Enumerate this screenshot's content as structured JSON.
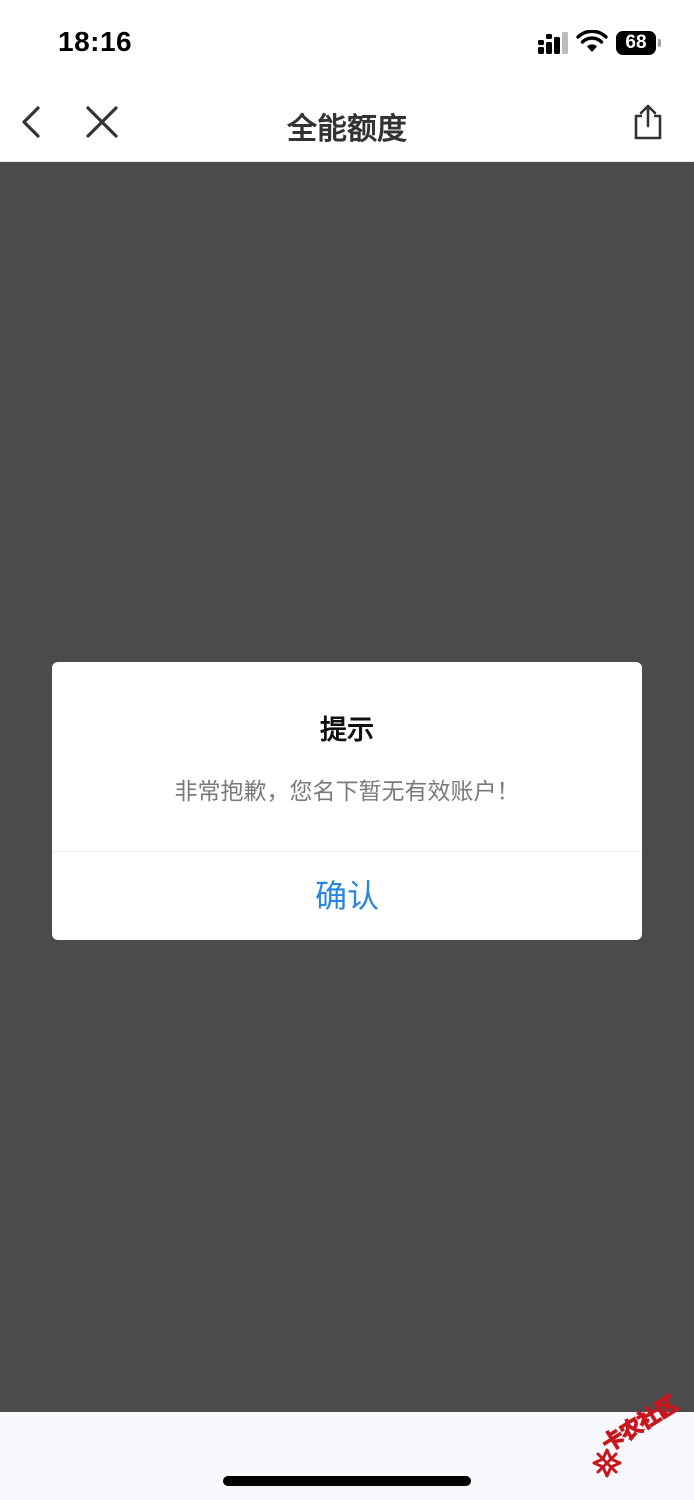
{
  "status_bar": {
    "time": "18:16",
    "battery_level": "68"
  },
  "nav": {
    "title": "全能额度",
    "icons": {
      "back": "chevron-left-icon",
      "close": "close-icon",
      "share": "share-icon"
    }
  },
  "dialog": {
    "title": "提示",
    "message": "非常抱歉，您名下暂无有效账户！",
    "confirm_label": "确认"
  },
  "watermark": {
    "text": "卡农社区"
  },
  "colors": {
    "accent": "#2a86e0",
    "overlay": "#4b4b4b",
    "watermark": "#c8161d"
  }
}
